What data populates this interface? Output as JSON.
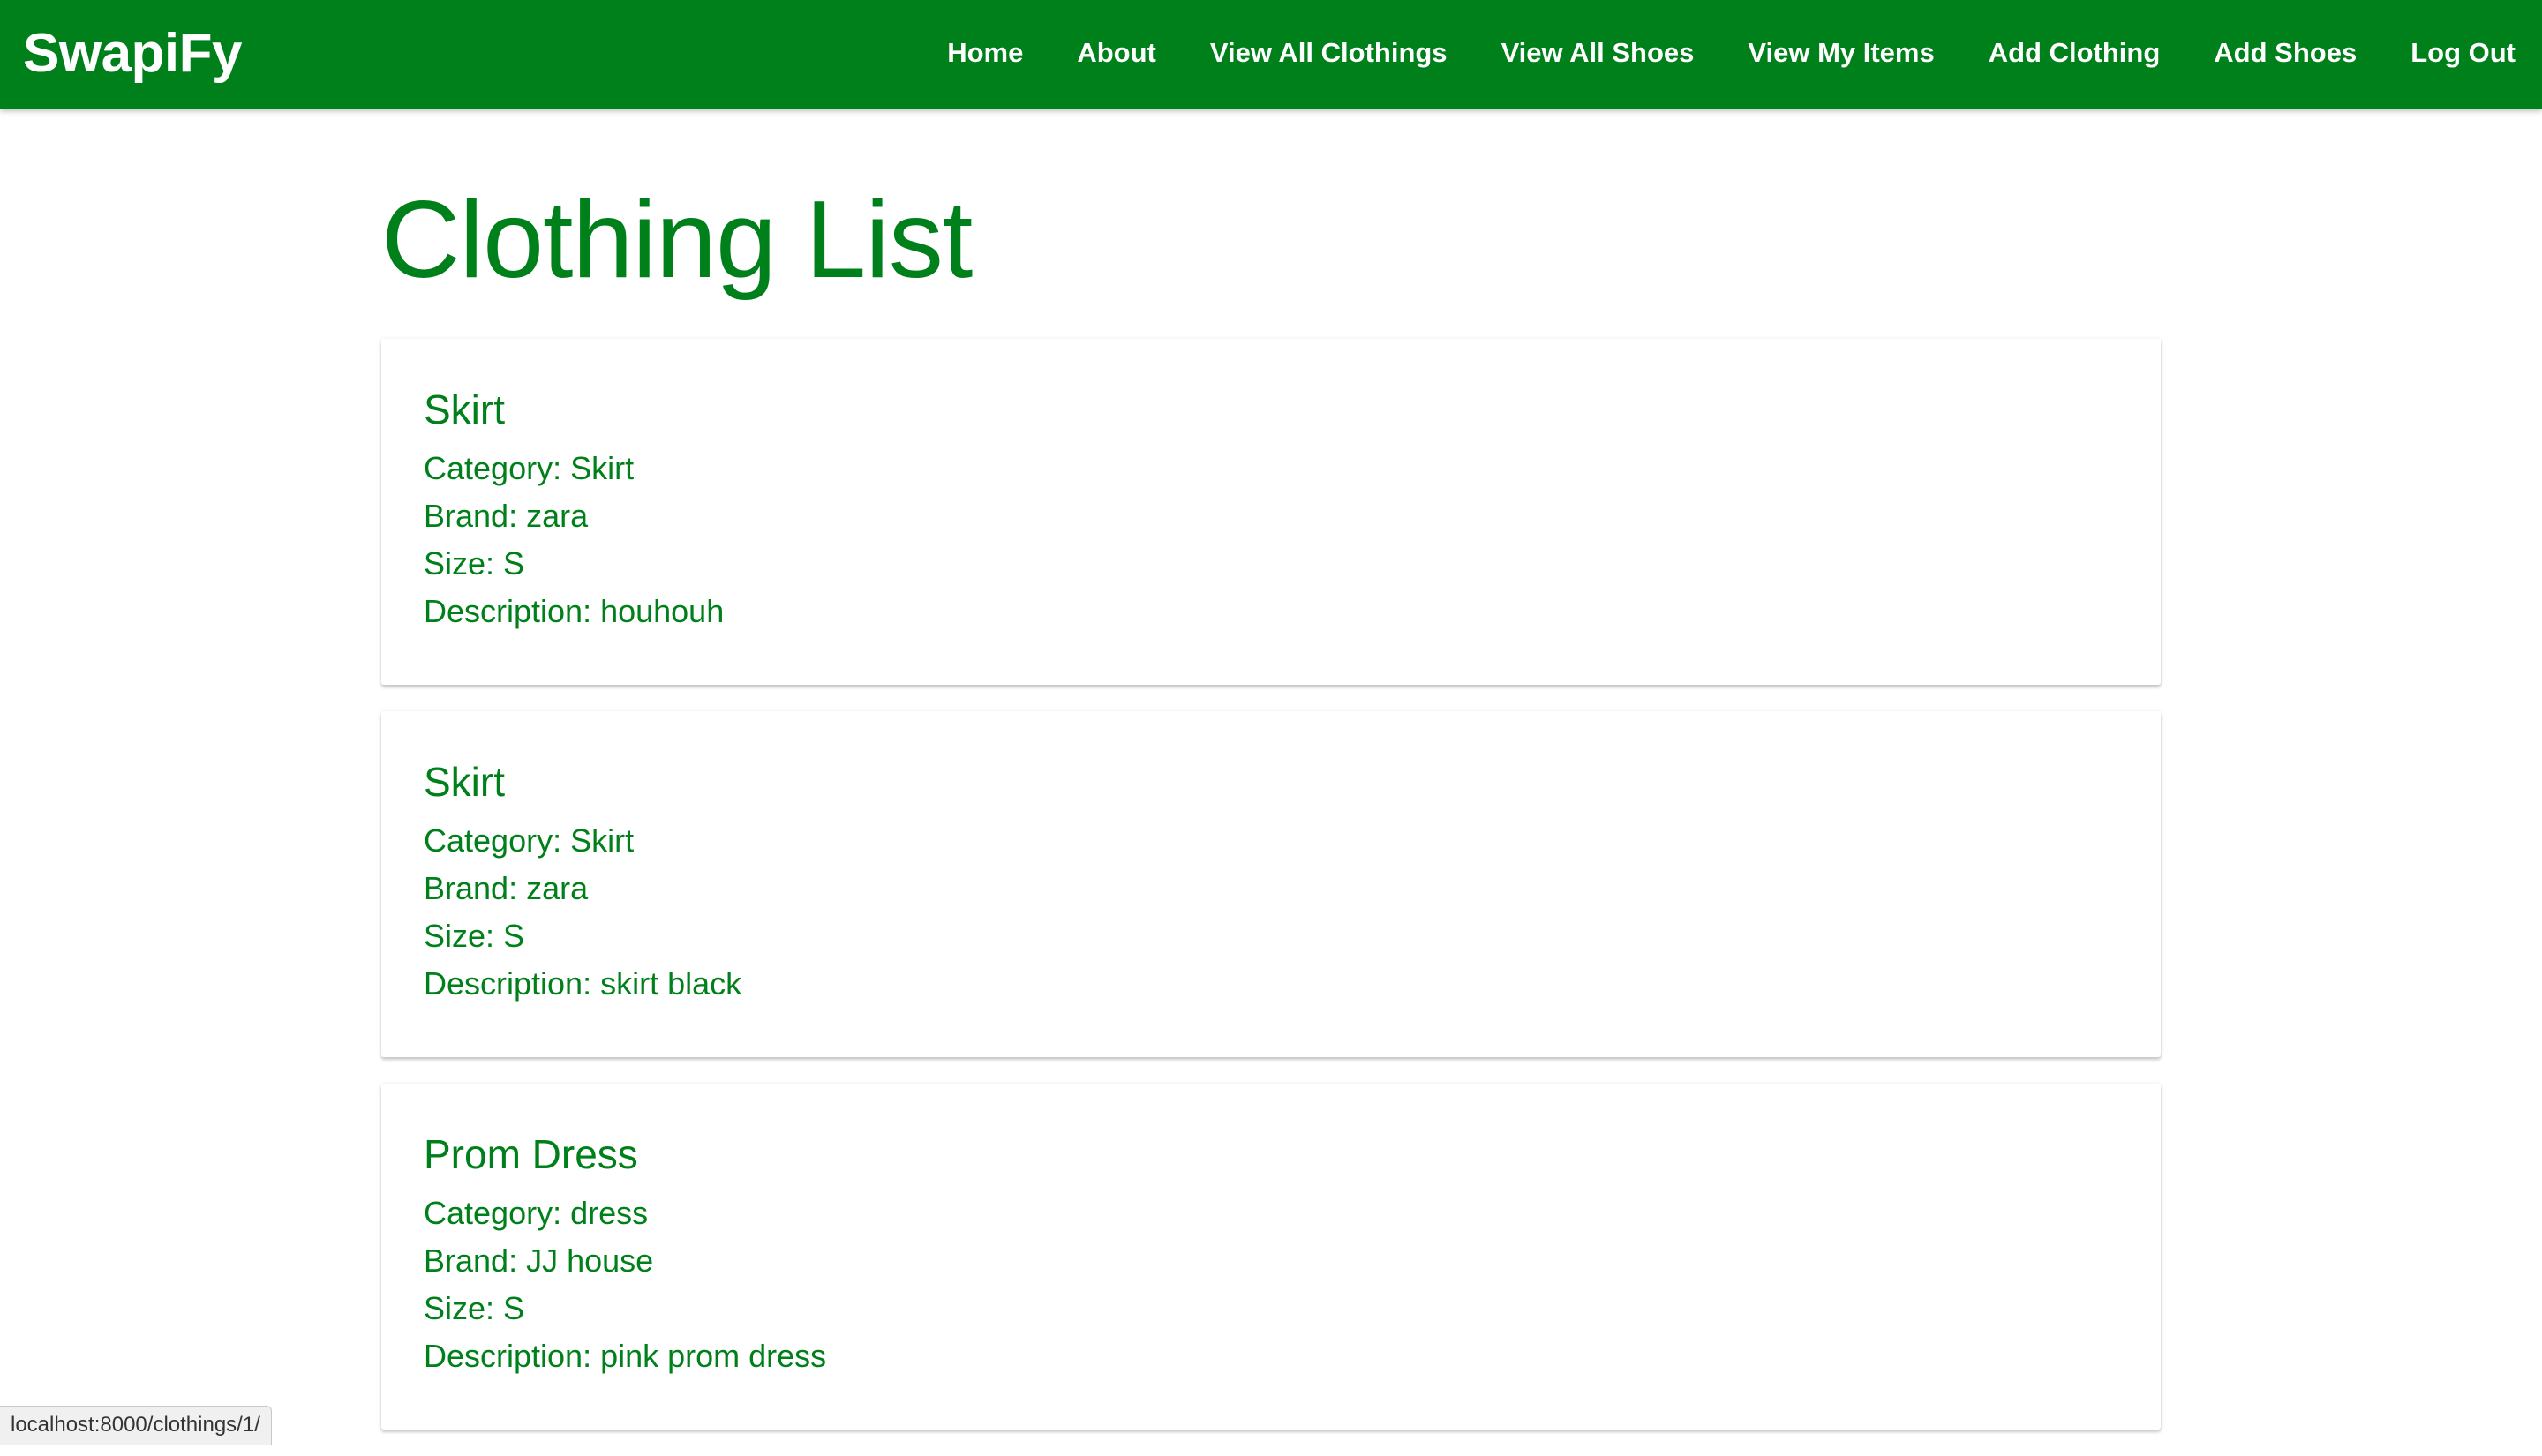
{
  "navbar": {
    "brand": "SwapiFy",
    "links": [
      {
        "label": "Home"
      },
      {
        "label": "About"
      },
      {
        "label": "View All Clothings"
      },
      {
        "label": "View All Shoes"
      },
      {
        "label": "View My Items"
      },
      {
        "label": "Add Clothing"
      },
      {
        "label": "Add Shoes"
      },
      {
        "label": "Log Out"
      }
    ]
  },
  "main": {
    "title": "Clothing List",
    "items": [
      {
        "name": "Skirt",
        "category": "Category: Skirt",
        "brand": "Brand: zara",
        "size": "Size: S",
        "description": "Description: houhouh"
      },
      {
        "name": "Skirt",
        "category": "Category: Skirt",
        "brand": "Brand: zara",
        "size": "Size: S",
        "description": "Description: skirt black"
      },
      {
        "name": "Prom Dress",
        "category": "Category: dress",
        "brand": "Brand: JJ house",
        "size": "Size: S",
        "description": "Description: pink prom dress"
      }
    ]
  },
  "status_bar": {
    "url": "localhost:8000/clothings/1/"
  },
  "colors": {
    "brand_green": "#00801a",
    "background": "#ffffff"
  }
}
